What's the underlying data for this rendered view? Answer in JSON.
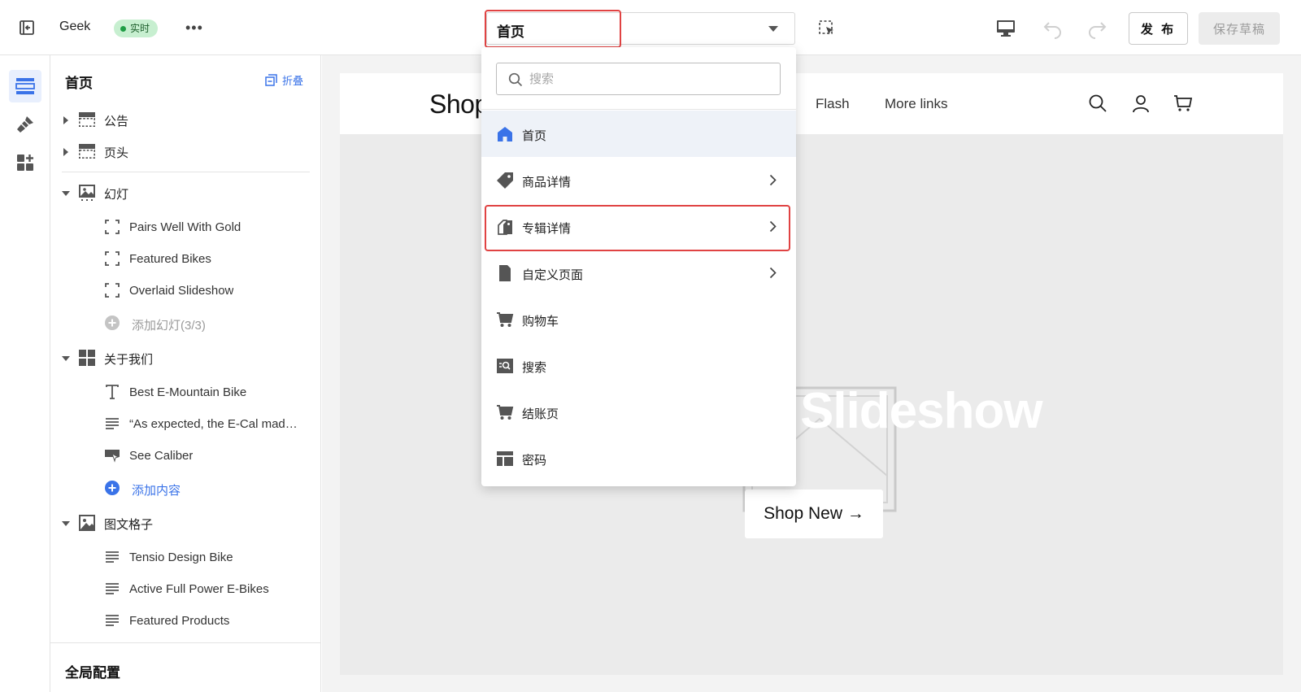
{
  "topbar": {
    "title": "Geek",
    "badge": "实时",
    "more": "•••",
    "page_select": "首页",
    "publish": "发 布",
    "save_draft": "保存草稿"
  },
  "panel": {
    "title": "首页",
    "collapse": "折叠",
    "sections": {
      "announcement": "公告",
      "header": "页头",
      "slideshow": "幻灯",
      "about": "关于我们",
      "image_grid": "图文格子"
    },
    "slideshow_items": [
      "Pairs Well With Gold",
      "Featured Bikes",
      "Overlaid Slideshow"
    ],
    "add_slide": "添加幻灯(3/3)",
    "about_items": [
      "Best E-Mountain Bike",
      "“As expected, the E-Cal mad…",
      "See Caliber"
    ],
    "add_content": "添加内容",
    "grid_items": [
      "Tensio Design Bike",
      "Active Full Power E-Bikes",
      "Featured Products"
    ],
    "global_config": "全局配置"
  },
  "dropdown": {
    "search_placeholder": "搜索",
    "items": [
      {
        "label": "首页",
        "icon": "home-icon",
        "selected": true,
        "has_submenu": false
      },
      {
        "label": "商品详情",
        "icon": "tag-icon",
        "selected": false,
        "has_submenu": true
      },
      {
        "label": "专辑详情",
        "icon": "collection-tag-icon",
        "selected": false,
        "has_submenu": true
      },
      {
        "label": "自定义页面",
        "icon": "page-icon",
        "selected": false,
        "has_submenu": true
      },
      {
        "label": "购物车",
        "icon": "cart-icon",
        "selected": false,
        "has_submenu": false
      },
      {
        "label": "搜索",
        "icon": "search-page-icon",
        "selected": false,
        "has_submenu": false
      },
      {
        "label": "结账页",
        "icon": "checkout-cart-icon",
        "selected": false,
        "has_submenu": false
      },
      {
        "label": "密码",
        "icon": "password-layout-icon",
        "selected": false,
        "has_submenu": false
      }
    ]
  },
  "preview": {
    "logo": "Shop",
    "nav": [
      "Flash",
      "More links"
    ],
    "slideshow_text": "Slideshow",
    "cta": "Shop New →"
  },
  "colors": {
    "accent": "#3a73e8",
    "highlight": "#e04343",
    "badge_bg": "#c7efd0",
    "badge_dot": "#1f9d45"
  }
}
